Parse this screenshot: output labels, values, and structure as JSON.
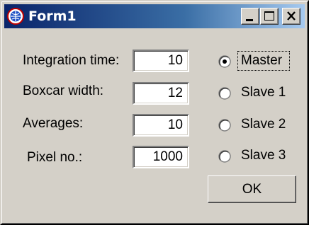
{
  "window": {
    "title": "Form1",
    "title_icon": "app-globe-icon",
    "buttons": {
      "minimize": "minimize-icon",
      "maximize": "maximize-icon",
      "close": "close-icon"
    }
  },
  "form": {
    "fields": [
      {
        "label": "Integration time:",
        "value": "10"
      },
      {
        "label": "Boxcar width:",
        "value": "12"
      },
      {
        "label": "Averages:",
        "value": "10"
      },
      {
        "label": "Pixel no.:",
        "value": "1000"
      }
    ],
    "radios": [
      {
        "label": "Master",
        "selected": true
      },
      {
        "label": "Slave 1",
        "selected": false
      },
      {
        "label": "Slave 2",
        "selected": false
      },
      {
        "label": "Slave 3",
        "selected": false
      }
    ],
    "ok_label": "OK"
  },
  "colors": {
    "titlebar_start": "#0a246a",
    "titlebar_end": "#a6caf0",
    "face": "#d4d0c8"
  }
}
